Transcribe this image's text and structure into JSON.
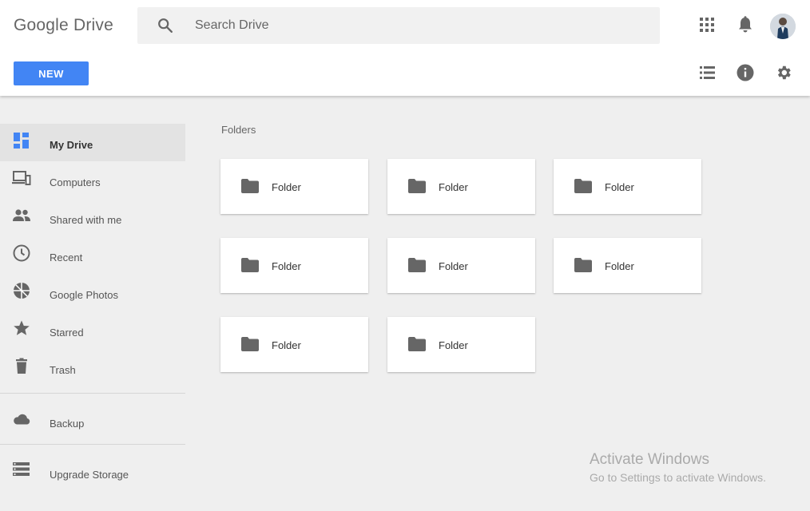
{
  "app": {
    "title": "Google Drive"
  },
  "search": {
    "placeholder": "Search Drive",
    "value": ""
  },
  "header_icons": [
    "apps-grid-icon",
    "notifications-bell-icon",
    "user-avatar"
  ],
  "toolbar": {
    "new_label": "NEW",
    "icons": [
      "list-view-icon",
      "info-icon",
      "settings-gear-icon"
    ]
  },
  "sidebar": {
    "items": [
      {
        "label": "My Drive",
        "icon": "my-drive-icon",
        "active": true
      },
      {
        "label": "Computers",
        "icon": "computers-icon"
      },
      {
        "label": "Shared with me",
        "icon": "shared-people-icon"
      },
      {
        "label": "Recent",
        "icon": "clock-icon"
      },
      {
        "label": "Google Photos",
        "icon": "photos-pinwheel-icon"
      },
      {
        "label": "Starred",
        "icon": "star-icon"
      },
      {
        "label": "Trash",
        "icon": "trash-icon"
      }
    ],
    "backup": {
      "label": "Backup",
      "icon": "cloud-icon"
    },
    "storage": {
      "label": "Upgrade Storage",
      "icon": "storage-icon"
    }
  },
  "main": {
    "section_title": "Folders",
    "folders": [
      {
        "label": "Folder"
      },
      {
        "label": "Folder"
      },
      {
        "label": "Folder"
      },
      {
        "label": "Folder"
      },
      {
        "label": "Folder"
      },
      {
        "label": "Folder"
      },
      {
        "label": "Folder"
      },
      {
        "label": "Folder"
      }
    ]
  },
  "watermark": {
    "line1": "Activate Windows",
    "line2": "Go to Settings to activate Windows."
  },
  "colors": {
    "accent": "#4285f4",
    "icon_gray": "#666666",
    "active_icon": "#4285f4"
  }
}
